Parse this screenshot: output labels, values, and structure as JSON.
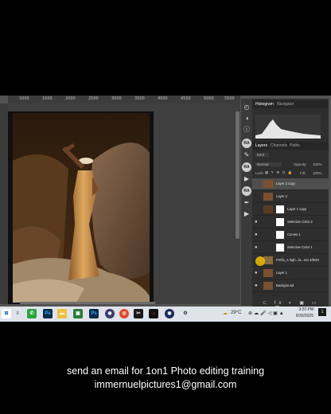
{
  "ruler": {
    "ticks": [
      "1000",
      "1500",
      "2000",
      "2500",
      "3000",
      "3500",
      "4000",
      "4500",
      "5000",
      "5500"
    ]
  },
  "panels": {
    "top_tabs": [
      "Histogram",
      "Navigator"
    ],
    "layer_tabs": [
      "Layers",
      "Channels",
      "Paths"
    ],
    "kind_label": "Kind",
    "blend_mode": "Normal",
    "opacity_label": "Opacity:",
    "opacity_value": "100%",
    "lock_label": "Lock:",
    "fill_label": "Fill:",
    "fill_value": "100%"
  },
  "side_badges": [
    "RA",
    "RA",
    "RA"
  ],
  "layers": [
    {
      "name": "Layer 2 copy",
      "selected": true,
      "eye": false,
      "mask": false
    },
    {
      "name": "Layer 2",
      "selected": false,
      "eye": false,
      "mask": false
    },
    {
      "name": "Layer 1 copy",
      "selected": false,
      "eye": false,
      "mask": true
    },
    {
      "name": "Selective Color 2",
      "selected": false,
      "eye": true,
      "mask": true
    },
    {
      "name": "Curves 1",
      "selected": false,
      "eye": true,
      "mask": true
    },
    {
      "name": "Selective Color 1",
      "selected": false,
      "eye": true,
      "mask": true
    },
    {
      "name": "Prefix_A high...la...ner 4/8/20",
      "selected": false,
      "eye": false,
      "mask": false
    },
    {
      "name": "Layer 1",
      "selected": false,
      "eye": true,
      "mask": false
    },
    {
      "name": "Background",
      "selected": false,
      "eye": true,
      "mask": false
    }
  ],
  "taskbar": {
    "weather": "29°C",
    "time": "3:20 PM",
    "date": "9/30/2025"
  },
  "caption": {
    "line1": "send an email for 1on1 Photo editing training",
    "line2": "immernuelpictures1@gmail.com"
  },
  "colors": {
    "accent": "#f0c000",
    "ps_bg": "#535353",
    "panel_bg": "#2e2e2e"
  }
}
